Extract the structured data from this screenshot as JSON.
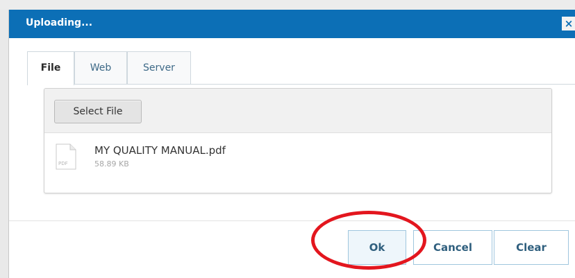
{
  "dialog": {
    "title": "Uploading...",
    "close_symbol": "×"
  },
  "tabs": [
    {
      "label": "File",
      "active": true
    },
    {
      "label": "Web",
      "active": false
    },
    {
      "label": "Server",
      "active": false
    }
  ],
  "upload": {
    "select_label": "Select File",
    "file": {
      "icon": "pdf-file-icon",
      "icon_text": "PDF",
      "name": "MY QUALITY MANUAL.pdf",
      "size": "58.89 KB"
    }
  },
  "footer": {
    "ok_label": "Ok",
    "cancel_label": "Cancel",
    "clear_label": "Clear"
  },
  "annotation": {
    "highlight_color": "#e3161e",
    "target": "ok"
  },
  "colors": {
    "titlebar": "#0c6fb6",
    "button_text": "#2f5f7e"
  }
}
